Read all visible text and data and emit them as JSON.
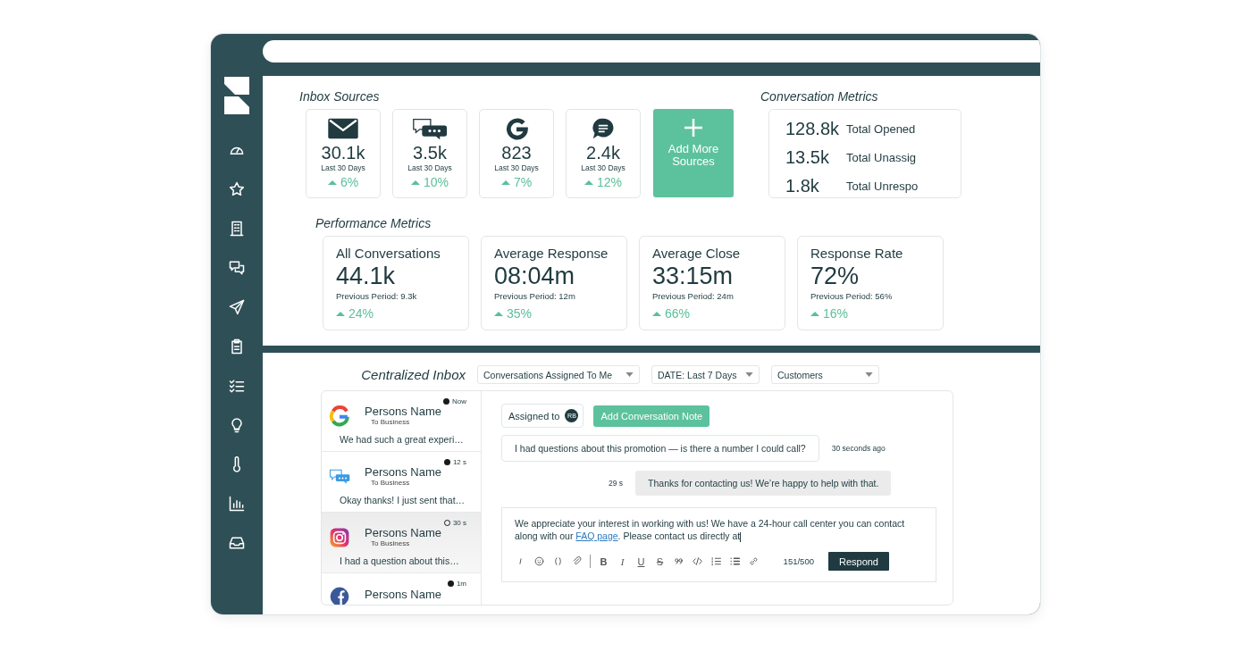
{
  "inbox_sources": {
    "title": "Inbox Sources",
    "cards": [
      {
        "kind": "email",
        "value": "30.1k",
        "period": "Last 30 Days",
        "change": "6%"
      },
      {
        "kind": "chat",
        "value": "3.5k",
        "period": "Last 30 Days",
        "change": "10%"
      },
      {
        "kind": "google",
        "value": "823",
        "period": "Last 30 Days",
        "change": "7%"
      },
      {
        "kind": "message",
        "value": "2.4k",
        "period": "Last 30 Days",
        "change": "12%"
      }
    ],
    "add_button": "Add More Sources"
  },
  "conversation_metrics": {
    "title": "Conversation Metrics",
    "rows": [
      {
        "value": "128.8k",
        "label": "Total Opened"
      },
      {
        "value": "13.5k",
        "label": "Total Unassig"
      },
      {
        "value": "1.8k",
        "label": "Total Unrespo"
      }
    ]
  },
  "performance_metrics": {
    "title": "Performance Metrics",
    "cards": [
      {
        "title": "All Conversations",
        "value": "44.1k",
        "previous": "Previous Period: 9.3k",
        "change": "24%"
      },
      {
        "title": "Average Response",
        "value": "08:04m",
        "previous": "Previous Period: 12m",
        "change": "35%"
      },
      {
        "title": "Average Close",
        "value": "33:15m",
        "previous": "Previous Period: 24m",
        "change": "66%"
      },
      {
        "title": "Response Rate",
        "value": "72%",
        "previous": "Previous Period: 56%",
        "change": "16%"
      }
    ]
  },
  "inbox": {
    "title": "Centralized Inbox",
    "filters": [
      "Conversations Assigned To Me",
      "DATE: Last 7 Days",
      "Customers"
    ],
    "conversations": [
      {
        "kind": "google",
        "name": "Persons Name",
        "subtitle": "To Business",
        "preview": "We had such a great experi…",
        "time": "Now",
        "unread": true,
        "selected": false
      },
      {
        "kind": "chat",
        "name": "Persons Name",
        "subtitle": "To Business",
        "preview": "Okay thanks! I just sent that…",
        "time": "12 s",
        "unread": true,
        "selected": false
      },
      {
        "kind": "instagram",
        "name": "Persons Name",
        "subtitle": "To Business",
        "preview": "I had a question about this…",
        "time": "30 s",
        "unread": false,
        "selected": true
      },
      {
        "kind": "facebook",
        "name": "Persons Name",
        "time": "1m",
        "unread": true,
        "selected": false
      }
    ],
    "detail": {
      "assigned_label": "Assigned to",
      "assignee_initials": "RB",
      "note_button": "Add Conversation Note",
      "messages": [
        {
          "kind": "incoming",
          "text": "I had questions about this promotion — is there a number I could call?",
          "time": "30 seconds ago"
        },
        {
          "kind": "outgoing",
          "text": "Thanks for contacting us! We’re happy to help with that.",
          "time": "29 s"
        }
      ],
      "draft": {
        "before": "We appreciate your interest in working with us! We have a 24-hour call center you can contact along with our ",
        "link": "FAQ page",
        "after": ". Please contact us directly at"
      },
      "format_buttons": [
        "B",
        "I",
        "U",
        "S"
      ],
      "counter": "151/500",
      "respond_button": "Respond"
    }
  }
}
